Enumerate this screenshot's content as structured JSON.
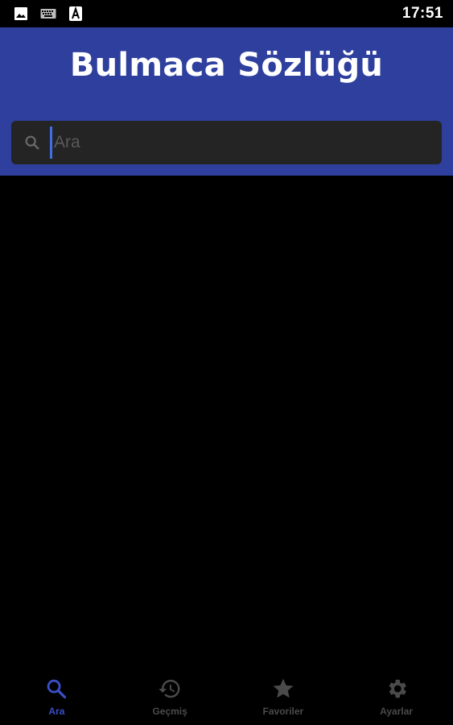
{
  "status_bar": {
    "time": "17:51",
    "icons": [
      "image-icon",
      "keyboard-icon",
      "font-icon"
    ]
  },
  "header": {
    "title": "Bulmaca Sözlüğü"
  },
  "search": {
    "placeholder": "Ara",
    "value": ""
  },
  "bottom_nav": {
    "items": [
      {
        "label": "Ara",
        "icon": "search-icon",
        "active": true
      },
      {
        "label": "Geçmiş",
        "icon": "history-icon",
        "active": false
      },
      {
        "label": "Favoriler",
        "icon": "star-icon",
        "active": false
      },
      {
        "label": "Ayarlar",
        "icon": "gear-icon",
        "active": false
      }
    ]
  },
  "colors": {
    "header_bg": "#2e3f9e",
    "accent": "#3a4fc8",
    "inactive": "#4a4a4a",
    "search_bg": "#242424"
  }
}
